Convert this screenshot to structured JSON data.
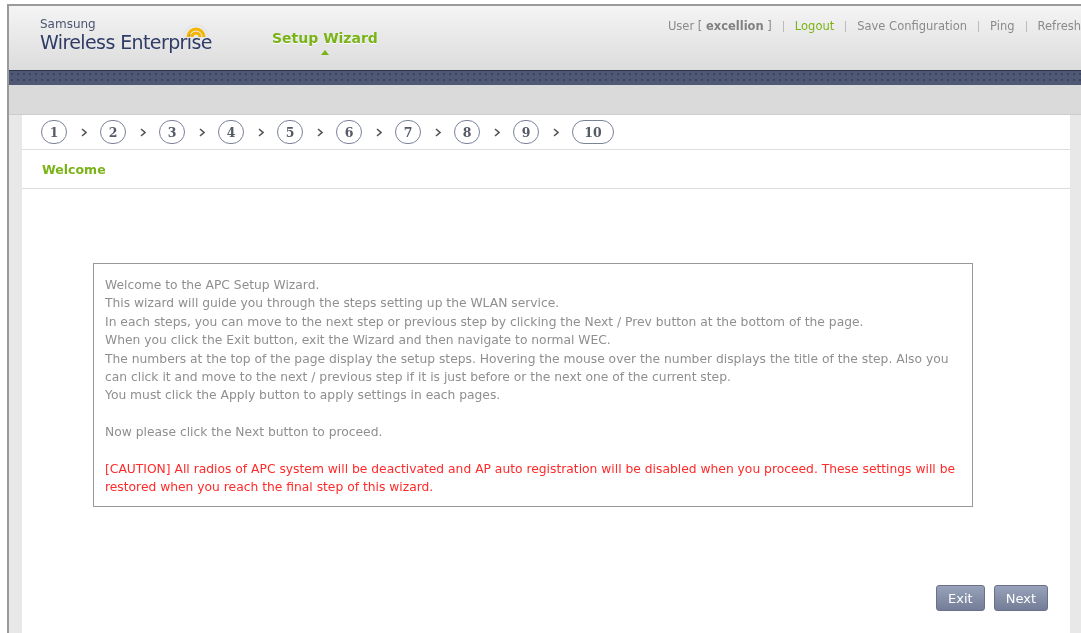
{
  "header": {
    "brand_top": "Samsung",
    "brand_name": "Wireless Enterprise",
    "nav": [
      {
        "label": "Setup Wizard",
        "selected": true
      }
    ],
    "user": {
      "prefix": "User [",
      "name": "excellion",
      "suffix": "]"
    },
    "links": [
      {
        "label": "Logout",
        "kind": "highlight"
      },
      {
        "label": "Save Configuration",
        "kind": "plain"
      },
      {
        "label": "Ping",
        "kind": "plain"
      },
      {
        "label": "Refresh",
        "kind": "plain"
      }
    ]
  },
  "steps": [
    "1",
    "2",
    "3",
    "4",
    "5",
    "6",
    "7",
    "8",
    "9",
    "10"
  ],
  "section_title": "Welcome",
  "message": {
    "lines": [
      "Welcome to the APC Setup Wizard.",
      "This wizard will guide you through the steps setting up the WLAN service.",
      "In each steps, you can move to the next step or previous step by clicking the Next / Prev button at the bottom of the page.",
      "When you click the Exit button, exit the Wizard and then navigate to normal WEC.",
      "The numbers at the top of the page display the setup steps. Hovering the mouse over the number displays the title of the step. Also you can click it and move to the next / previous step if it is just before or the next one of the current step.",
      "You must click the Apply button to apply settings in each pages."
    ],
    "prompt": "Now please click the Next button to proceed.",
    "caution": "[CAUTION] All radios of APC system will be deactivated and AP auto registration will be disabled when you proceed. These settings will be restored when you reach the final step of this wizard."
  },
  "buttons": [
    "Exit",
    "Next"
  ]
}
